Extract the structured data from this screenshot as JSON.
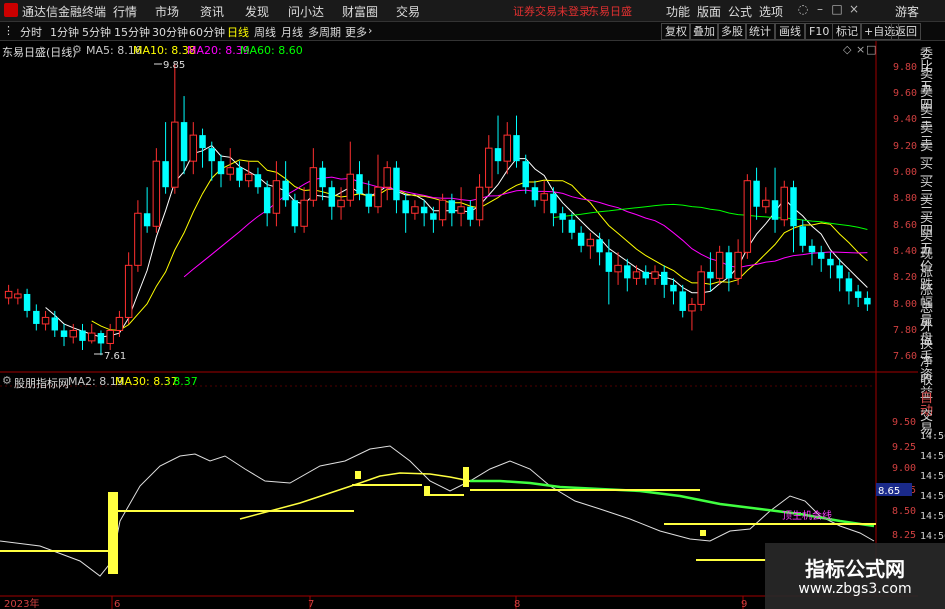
{
  "menubar": {
    "app_title": "通达信金融终端",
    "items": [
      "行情",
      "市场",
      "资讯",
      "发现",
      "问小达",
      "财富圈",
      "交易"
    ],
    "warning": "证券交易未登录",
    "stock_name": "东易日盛",
    "right_items": [
      "功能",
      "版面",
      "公式",
      "选项"
    ],
    "user": "游客"
  },
  "toolbar": {
    "periods": [
      "分时",
      "1分钟",
      "5分钟",
      "15分钟",
      "30分钟",
      "60分钟",
      "日线",
      "周线",
      "月线",
      "多周期",
      "更多"
    ],
    "active_period": "日线",
    "right_buttons": [
      "复权",
      "叠加",
      "多股",
      "统计",
      "画线",
      "F10",
      "标记",
      "+自选",
      "返回"
    ]
  },
  "main_chart": {
    "title": "东易日盛(日线)",
    "ma_labels": [
      {
        "text": "MA5: 8.16",
        "color": "#ffffff"
      },
      {
        "text": "MA10: 8.38",
        "color": "#ffff00"
      },
      {
        "text": "MA20: 8.39",
        "color": "#ff00ff"
      },
      {
        "text": "MA60: 8.60",
        "color": "#00ff00"
      }
    ],
    "high_label": "9.85",
    "low_label": "7.61",
    "y_ticks": [
      "9.80",
      "9.60",
      "9.40",
      "9.20",
      "9.00",
      "8.80",
      "8.60",
      "8.40",
      "8.20",
      "8.00",
      "7.80",
      "7.60"
    ],
    "up_color": "#ff3030",
    "down_color": "#00ffff"
  },
  "indicator": {
    "title": "股朋指标网",
    "labels": [
      {
        "text": "MA2: 8.19",
        "color": "#ffffff"
      },
      {
        "text": "MA30: 8.37",
        "color": "#ffff00"
      },
      {
        "text": ": 8.37",
        "color": "#00ff00"
      }
    ],
    "y_ticks": [
      "9.50",
      "9.25",
      "9.00",
      "8.75",
      "8.50",
      "8.25"
    ],
    "current_value": "8.65",
    "note": "顶生机会线"
  },
  "x_axis": [
    "2023年",
    "6",
    "7",
    "8",
    "9"
  ],
  "side_panel": {
    "labels": [
      "委比",
      "卖五",
      "卖四",
      "卖三",
      "卖二",
      "卖一",
      "买一",
      "买二",
      "买三",
      "买四",
      "买五",
      "现价",
      "涨跌",
      "涨幅",
      "总量",
      "外盘",
      "换手",
      "净资",
      "收益"
    ],
    "bottom_labels": [
      "自动",
      "交易"
    ],
    "times": [
      "14:56",
      "14:56",
      "14:56",
      "14:56",
      "14:56",
      "14:56",
      "14:56",
      "14:56",
      "14:56"
    ]
  },
  "watermark": {
    "line1": "指标公式网",
    "line2": "www.zbgs3.com"
  },
  "chart_data": {
    "type": "candlestick",
    "candles": [
      [
        8.05,
        8.1,
        8.15,
        8.0
      ],
      [
        8.05,
        8.08,
        8.12,
        8.0
      ],
      [
        8.08,
        7.95,
        8.12,
        7.9
      ],
      [
        7.95,
        7.85,
        8.0,
        7.8
      ],
      [
        7.85,
        7.9,
        7.95,
        7.8
      ],
      [
        7.9,
        7.8,
        7.95,
        7.75
      ],
      [
        7.8,
        7.75,
        7.85,
        7.68
      ],
      [
        7.75,
        7.8,
        7.85,
        7.7
      ],
      [
        7.8,
        7.72,
        7.85,
        7.65
      ],
      [
        7.72,
        7.78,
        7.85,
        7.7
      ],
      [
        7.78,
        7.7,
        7.8,
        7.61
      ],
      [
        7.7,
        7.8,
        7.85,
        7.65
      ],
      [
        7.8,
        7.9,
        7.95,
        7.75
      ],
      [
        7.9,
        8.3,
        8.4,
        7.85
      ],
      [
        8.3,
        8.7,
        8.8,
        8.25
      ],
      [
        8.7,
        8.6,
        8.9,
        8.55
      ],
      [
        8.6,
        9.1,
        9.2,
        8.55
      ],
      [
        9.1,
        8.9,
        9.4,
        8.85
      ],
      [
        8.9,
        9.4,
        9.85,
        8.85
      ],
      [
        9.4,
        9.1,
        9.6,
        9.0
      ],
      [
        9.1,
        9.3,
        9.4,
        9.0
      ],
      [
        9.3,
        9.2,
        9.35,
        9.05
      ],
      [
        9.2,
        9.1,
        9.25,
        8.95
      ],
      [
        9.1,
        9.0,
        9.15,
        8.9
      ],
      [
        9.0,
        9.05,
        9.2,
        8.95
      ],
      [
        9.05,
        8.95,
        9.1,
        8.9
      ],
      [
        8.95,
        9.0,
        9.1,
        8.9
      ],
      [
        9.0,
        8.9,
        9.05,
        8.85
      ],
      [
        8.9,
        8.7,
        8.95,
        8.6
      ],
      [
        8.7,
        8.95,
        9.1,
        8.6
      ],
      [
        8.95,
        8.8,
        9.1,
        8.75
      ],
      [
        8.8,
        8.6,
        8.85,
        8.55
      ],
      [
        8.6,
        8.8,
        8.9,
        8.55
      ],
      [
        8.8,
        9.05,
        9.2,
        8.75
      ],
      [
        9.05,
        8.9,
        9.1,
        8.8
      ],
      [
        8.9,
        8.75,
        8.95,
        8.65
      ],
      [
        8.75,
        8.8,
        8.9,
        8.65
      ],
      [
        8.8,
        9.0,
        9.25,
        8.75
      ],
      [
        9.0,
        8.85,
        9.1,
        8.8
      ],
      [
        8.85,
        8.75,
        8.95,
        8.7
      ],
      [
        8.75,
        8.9,
        9.15,
        8.7
      ],
      [
        8.9,
        9.05,
        9.1,
        8.8
      ],
      [
        9.05,
        8.8,
        9.1,
        8.7
      ],
      [
        8.8,
        8.7,
        8.85,
        8.55
      ],
      [
        8.7,
        8.75,
        8.8,
        8.65
      ],
      [
        8.75,
        8.7,
        8.8,
        8.6
      ],
      [
        8.7,
        8.65,
        8.75,
        8.55
      ],
      [
        8.65,
        8.8,
        8.85,
        8.6
      ],
      [
        8.8,
        8.7,
        8.85,
        8.6
      ],
      [
        8.7,
        8.75,
        8.9,
        8.6
      ],
      [
        8.75,
        8.65,
        8.8,
        8.6
      ],
      [
        8.65,
        8.9,
        9.0,
        8.6
      ],
      [
        8.9,
        9.2,
        9.3,
        8.85
      ],
      [
        9.2,
        9.1,
        9.45,
        9.0
      ],
      [
        9.1,
        9.3,
        9.4,
        9.0
      ],
      [
        9.3,
        9.1,
        9.45,
        9.05
      ],
      [
        9.1,
        8.9,
        9.15,
        8.85
      ],
      [
        8.9,
        8.8,
        8.95,
        8.75
      ],
      [
        8.8,
        8.85,
        8.95,
        8.7
      ],
      [
        8.85,
        8.7,
        8.9,
        8.6
      ],
      [
        8.7,
        8.65,
        8.75,
        8.55
      ],
      [
        8.65,
        8.55,
        8.7,
        8.5
      ],
      [
        8.55,
        8.45,
        8.6,
        8.4
      ],
      [
        8.45,
        8.5,
        8.55,
        8.35
      ],
      [
        8.5,
        8.4,
        8.55,
        8.3
      ],
      [
        8.4,
        8.25,
        8.5,
        8.0
      ],
      [
        8.25,
        8.3,
        8.4,
        8.15
      ],
      [
        8.3,
        8.2,
        8.35,
        8.1
      ],
      [
        8.2,
        8.25,
        8.3,
        8.15
      ],
      [
        8.25,
        8.2,
        8.3,
        8.15
      ],
      [
        8.2,
        8.25,
        8.3,
        8.15
      ],
      [
        8.25,
        8.15,
        8.3,
        8.05
      ],
      [
        8.15,
        8.1,
        8.2,
        8.0
      ],
      [
        8.1,
        7.95,
        8.15,
        7.9
      ],
      [
        7.95,
        8.0,
        8.05,
        7.8
      ],
      [
        8.0,
        8.25,
        8.3,
        7.95
      ],
      [
        8.25,
        8.2,
        8.4,
        8.1
      ],
      [
        8.2,
        8.4,
        8.45,
        8.15
      ],
      [
        8.4,
        8.2,
        8.45,
        8.1
      ],
      [
        8.2,
        8.4,
        8.5,
        8.15
      ],
      [
        8.4,
        8.95,
        9.0,
        8.35
      ],
      [
        8.95,
        8.75,
        9.05,
        8.65
      ],
      [
        8.75,
        8.8,
        8.9,
        8.7
      ],
      [
        8.8,
        8.65,
        9.05,
        8.55
      ],
      [
        8.65,
        8.9,
        8.95,
        8.6
      ],
      [
        8.9,
        8.6,
        8.95,
        8.4
      ],
      [
        8.6,
        8.45,
        8.65,
        8.4
      ],
      [
        8.45,
        8.4,
        8.5,
        8.3
      ],
      [
        8.4,
        8.35,
        8.45,
        8.25
      ],
      [
        8.35,
        8.3,
        8.4,
        8.2
      ],
      [
        8.3,
        8.2,
        8.35,
        8.1
      ],
      [
        8.2,
        8.1,
        8.25,
        8.0
      ],
      [
        8.1,
        8.05,
        8.15,
        7.98
      ],
      [
        8.05,
        8.0,
        8.1,
        7.95
      ]
    ],
    "ylim": [
      7.55,
      9.9
    ]
  }
}
